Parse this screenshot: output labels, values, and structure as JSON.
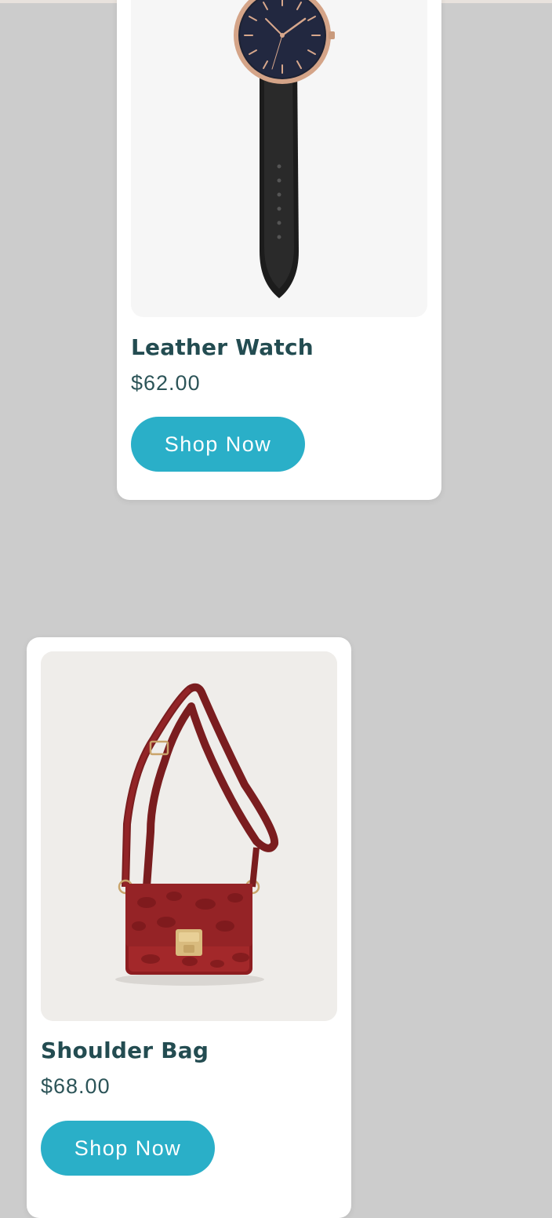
{
  "products": [
    {
      "name": "Leather Watch",
      "price": "$62.00",
      "button_label": "Shop Now",
      "image": "leather-watch-photo"
    },
    {
      "name": "Shoulder Bag",
      "price": "$68.00",
      "button_label": "Shop Now",
      "image": "shoulder-bag-photo"
    }
  ],
  "colors": {
    "page_background": "#cccccc",
    "card_background": "#ffffff",
    "title_text": "#234c51",
    "price_text": "#2c5458",
    "button_background": "#2aafc8",
    "button_text": "#ffffff"
  }
}
